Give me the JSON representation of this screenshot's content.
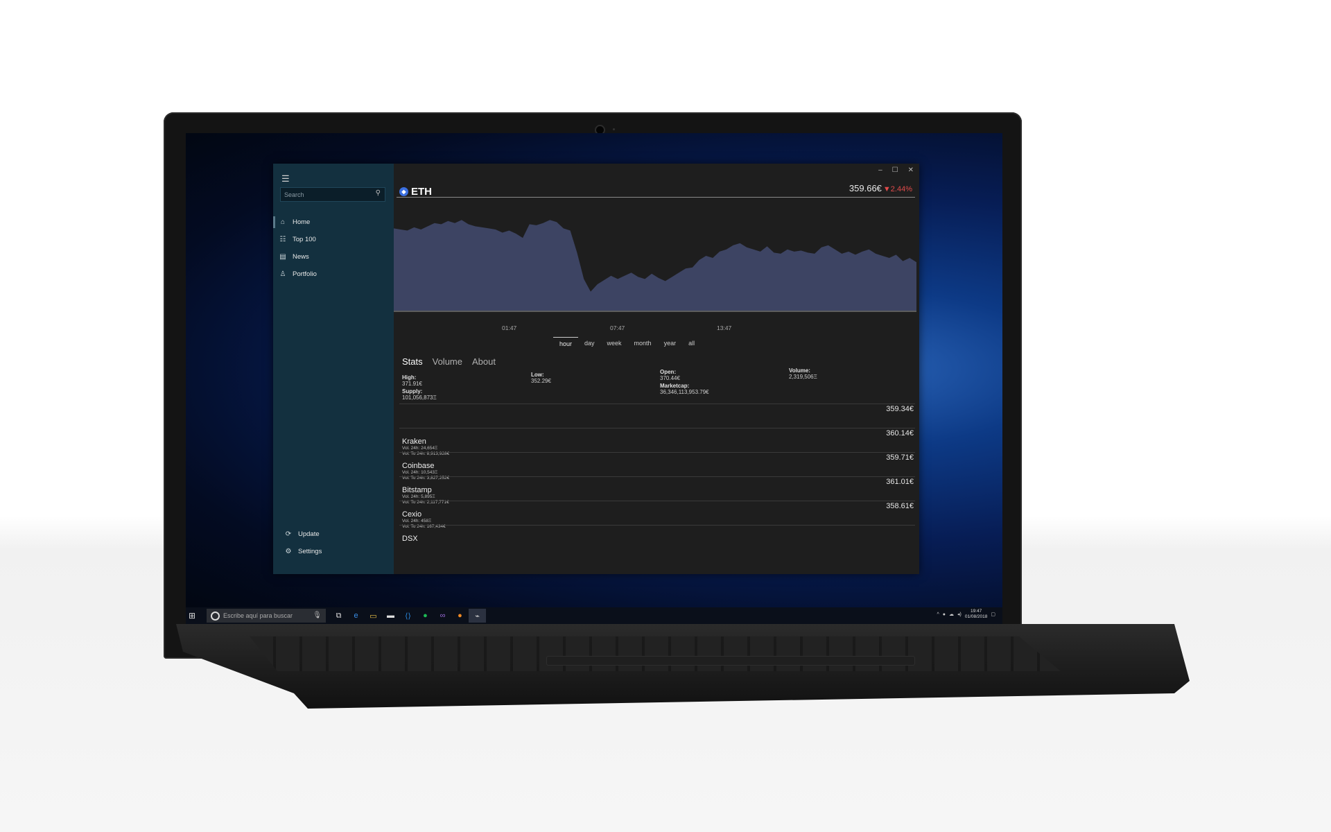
{
  "app": {
    "search_placeholder": "Search",
    "nav": [
      {
        "label": "Home",
        "icon": "home-icon"
      },
      {
        "label": "Top 100",
        "icon": "list-icon"
      },
      {
        "label": "News",
        "icon": "news-icon"
      },
      {
        "label": "Portfolio",
        "icon": "person-icon"
      }
    ],
    "nav_bottom": [
      {
        "label": "Update",
        "icon": "refresh-icon"
      },
      {
        "label": "Settings",
        "icon": "gear-icon"
      }
    ]
  },
  "coin": {
    "symbol": "ETH",
    "price": "359.66€",
    "change": "▼2.44%",
    "change_color": "#e14b4b"
  },
  "chart_data": {
    "type": "area",
    "x_ticks": [
      "01:47",
      "07:47",
      "13:47"
    ],
    "fill_color": "#3d4463",
    "values": [
      0.78,
      0.77,
      0.76,
      0.79,
      0.77,
      0.8,
      0.83,
      0.82,
      0.85,
      0.83,
      0.86,
      0.82,
      0.8,
      0.79,
      0.78,
      0.77,
      0.74,
      0.76,
      0.73,
      0.69,
      0.82,
      0.81,
      0.83,
      0.86,
      0.84,
      0.78,
      0.76,
      0.55,
      0.3,
      0.18,
      0.25,
      0.29,
      0.33,
      0.3,
      0.33,
      0.36,
      0.32,
      0.3,
      0.35,
      0.31,
      0.28,
      0.32,
      0.36,
      0.4,
      0.41,
      0.48,
      0.52,
      0.5,
      0.56,
      0.58,
      0.62,
      0.64,
      0.6,
      0.58,
      0.56,
      0.61,
      0.55,
      0.54,
      0.58,
      0.56,
      0.57,
      0.55,
      0.54,
      0.6,
      0.62,
      0.58,
      0.54,
      0.56,
      0.53,
      0.56,
      0.58,
      0.54,
      0.52,
      0.5,
      0.53,
      0.47,
      0.5,
      0.46
    ]
  },
  "ranges": [
    "hour",
    "day",
    "week",
    "month",
    "year",
    "all"
  ],
  "tabs": [
    "Stats",
    "Volume",
    "About"
  ],
  "stats": {
    "high_label": "High:",
    "high": "371.91€",
    "supply_label": "Supply:",
    "supply": "101,056,873Ξ",
    "low_label": "Low:",
    "low": "352.29€",
    "open_label": "Open:",
    "open": "370.44€",
    "marketcap_label": "Marketcap:",
    "marketcap": "36,346,113,953.79€",
    "volume_label": "Volume:",
    "volume": "2,319,506Ξ"
  },
  "exchanges": [
    {
      "name": "",
      "price": "359.34€",
      "vol": "",
      "volto": ""
    },
    {
      "name": "Kraken",
      "price": "360.14€",
      "vol": "Vol. 24h: 24,654Ξ",
      "volto": "Vol. To 24h: 8,913,928€"
    },
    {
      "name": "Coinbase",
      "price": "359.71€",
      "vol": "Vol. 24h: 10,543Ξ",
      "volto": "Vol. To 24h: 3,827,252€"
    },
    {
      "name": "Bitstamp",
      "price": "361.01€",
      "vol": "Vol. 24h: 5,895Ξ",
      "volto": "Vol. To 24h: 2,117,771€"
    },
    {
      "name": "Cexio",
      "price": "358.61€",
      "vol": "Vol. 24h: 458Ξ",
      "volto": "Vol. To 24h: 167,434€"
    },
    {
      "name": "DSX",
      "price": "",
      "vol": "",
      "volto": ""
    }
  ],
  "taskbar": {
    "search_placeholder": "Escribe aquí para buscar",
    "time": "19:47",
    "date": "01/08/2018"
  }
}
